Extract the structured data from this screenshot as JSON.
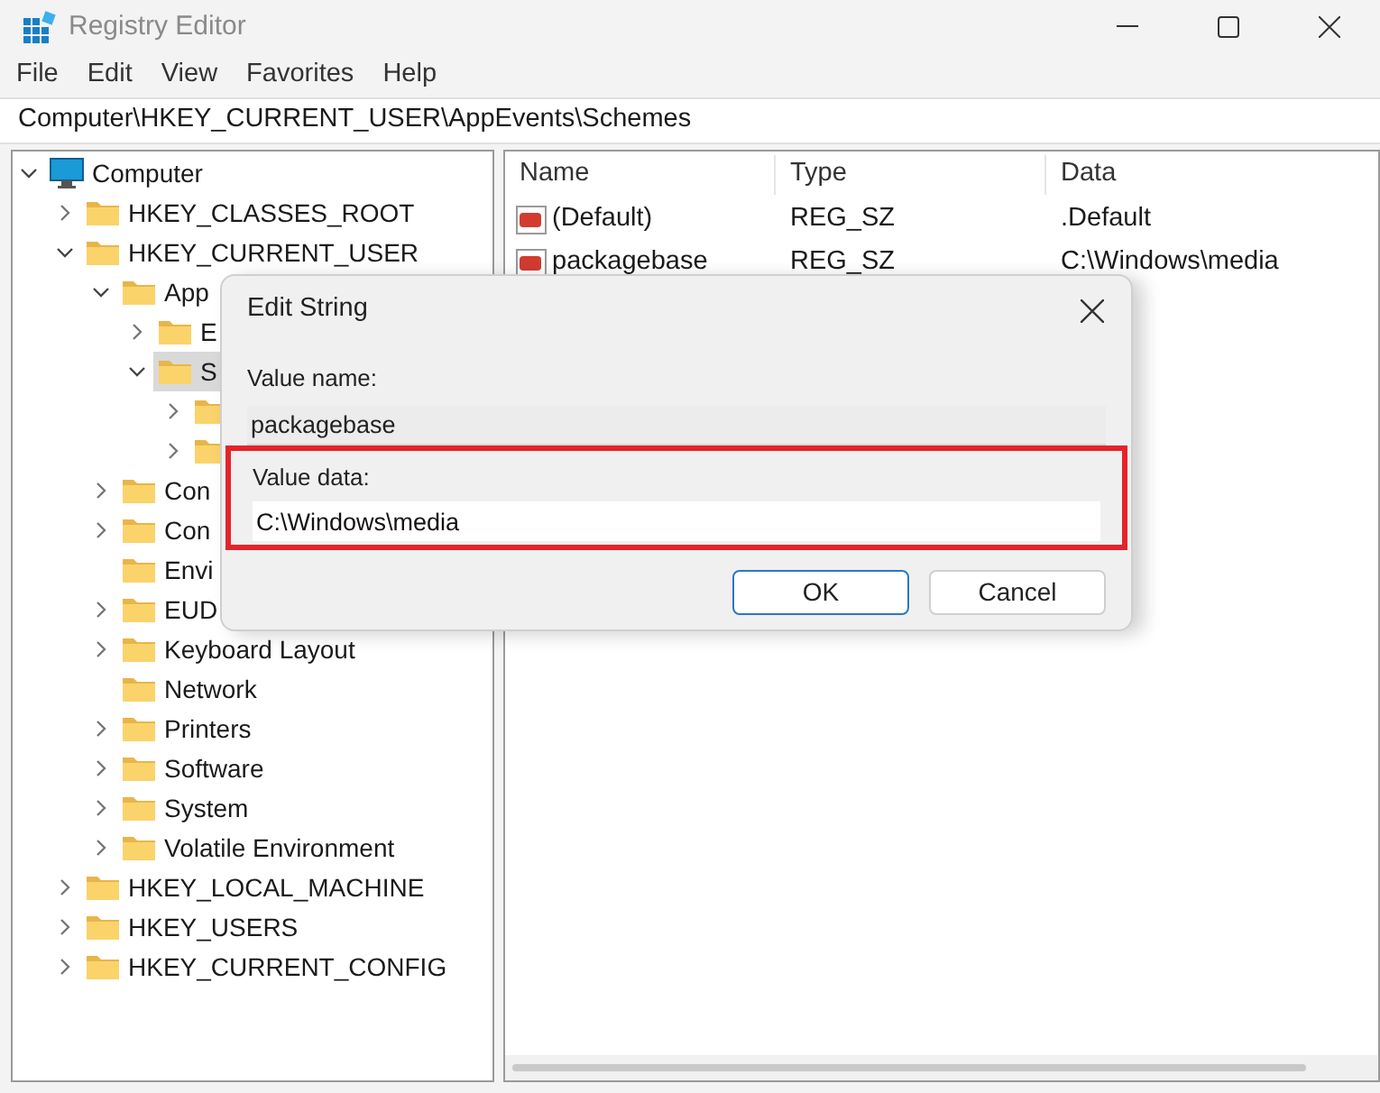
{
  "window": {
    "title": "Registry Editor"
  },
  "menu": [
    "File",
    "Edit",
    "View",
    "Favorites",
    "Help"
  ],
  "address": "Computer\\HKEY_CURRENT_USER\\AppEvents\\Schemes",
  "tree": [
    {
      "label": "Computer",
      "kind": "computer",
      "expanded": true,
      "selected": false,
      "children": [
        {
          "label": "HKEY_CLASSES_ROOT",
          "kind": "key",
          "expanded": false,
          "selected": false
        },
        {
          "label": "HKEY_CURRENT_USER",
          "kind": "key",
          "expanded": true,
          "selected": false,
          "children": [
            {
              "label": "App",
              "kind": "key",
              "expanded": true,
              "selected": false,
              "children": [
                {
                  "label": "E",
                  "kind": "key",
                  "expanded": false,
                  "selected": false
                },
                {
                  "label": "S",
                  "kind": "key",
                  "expanded": true,
                  "selected": true,
                  "children": [
                    {
                      "kind": "key",
                      "expanded": false,
                      "selected": false
                    },
                    {
                      "kind": "key",
                      "expanded": false,
                      "selected": false
                    }
                  ]
                }
              ]
            },
            {
              "label": "Con",
              "kind": "key",
              "expanded": false,
              "selected": false
            },
            {
              "label": "Con",
              "kind": "key",
              "expanded": false,
              "selected": false
            },
            {
              "label": "Envi",
              "kind": "leaf",
              "expanded": false,
              "selected": false
            },
            {
              "label": "EUD",
              "kind": "key",
              "expanded": false,
              "selected": false
            },
            {
              "label": "Keyboard Layout",
              "kind": "key",
              "expanded": false,
              "selected": false
            },
            {
              "label": "Network",
              "kind": "leaf",
              "expanded": false,
              "selected": false
            },
            {
              "label": "Printers",
              "kind": "key",
              "expanded": false,
              "selected": false
            },
            {
              "label": "Software",
              "kind": "key",
              "expanded": false,
              "selected": false
            },
            {
              "label": "System",
              "kind": "key",
              "expanded": false,
              "selected": false
            },
            {
              "label": "Volatile Environment",
              "kind": "key",
              "expanded": false,
              "selected": false
            }
          ]
        },
        {
          "label": "HKEY_LOCAL_MACHINE",
          "kind": "key",
          "expanded": false,
          "selected": false
        },
        {
          "label": "HKEY_USERS",
          "kind": "key",
          "expanded": false,
          "selected": false
        },
        {
          "label": "HKEY_CURRENT_CONFIG",
          "kind": "key",
          "expanded": false,
          "selected": false
        }
      ]
    }
  ],
  "values": {
    "columns": [
      "Name",
      "Type",
      "Data"
    ],
    "rows": [
      {
        "name": "(Default)",
        "type": "REG_SZ",
        "data": ".Default"
      },
      {
        "name": "packagebase",
        "type": "REG_SZ",
        "data": "C:\\Windows\\media"
      }
    ]
  },
  "dialog": {
    "title": "Edit String",
    "name_label": "Value name:",
    "name_value": "packagebase",
    "data_label": "Value data:",
    "data_value": "C:\\Windows\\media",
    "highlighted": true,
    "buttons": [
      {
        "label": "OK",
        "default": true
      },
      {
        "label": "Cancel",
        "default": false
      }
    ]
  }
}
